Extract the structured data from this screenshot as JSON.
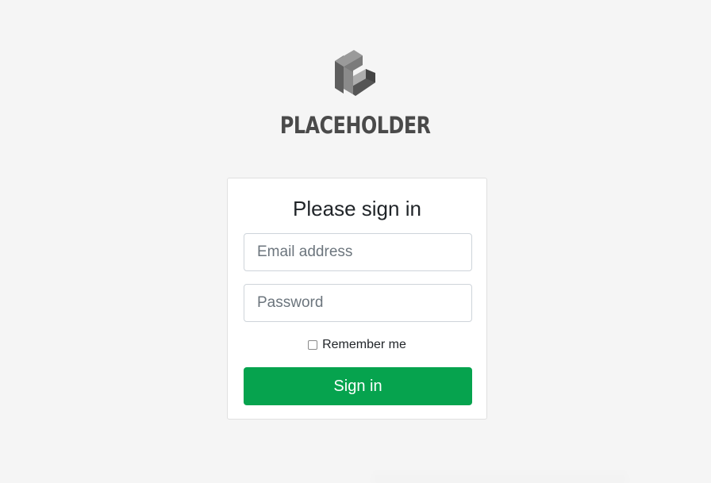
{
  "brand": {
    "logo_icon": "cube-c-logo-icon",
    "name": "PLACEHOLDER"
  },
  "login": {
    "title": "Please sign in",
    "email_placeholder": "Email address",
    "email_value": "",
    "password_placeholder": "Password",
    "password_value": "",
    "remember_label": "Remember me",
    "remember_checked": false,
    "submit_label": "Sign in"
  },
  "colors": {
    "background": "#f5f5f5",
    "card": "#ffffff",
    "primary_button": "#06a34e",
    "logo_text": "#4a4a4a"
  }
}
